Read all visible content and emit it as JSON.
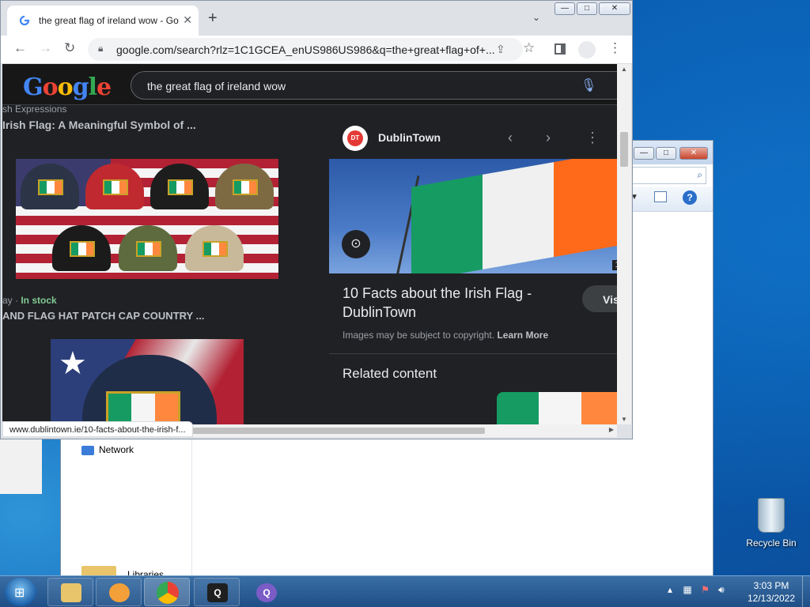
{
  "browser": {
    "tab_title": "the great flag of ireland wow - Go",
    "url": "google.com/search?rlz=1C1GCEA_enUS986US986&q=the+great+flag+of+...",
    "status_url": "www.dublintown.ie/10-facts-about-the-irish-f..."
  },
  "google": {
    "logo": "Google",
    "query": "the great flag of ireland wow"
  },
  "results": {
    "r1_source": "sh Expressions",
    "r1_title": "Irish Flag: A Meaningful Symbol of ...",
    "r2_meta": "ay · ",
    "r2_stock": "In stock",
    "r2_title": "AND FLAG HAT PATCH CAP COUNTRY ..."
  },
  "panel": {
    "source": "DublinTown",
    "logo_text": "DT",
    "badge": "1",
    "title": "10 Facts about the Irish Flag - DublinTown",
    "visit": "Vis",
    "copyright": "Images may be subject to copyright.",
    "learn_more": "Learn More",
    "related": "Related content"
  },
  "explorer": {
    "nav_network": "Network",
    "libraries": "Libraries"
  },
  "desktop": {
    "recycle_bin": "Recycle Bin"
  },
  "taskbar": {
    "time": "3:03 PM",
    "date": "12/13/2022"
  },
  "colors": {
    "irish_green": "#169b62",
    "irish_white": "#f5f5f5",
    "irish_orange": "#ff883e",
    "google_dark": "#202124"
  }
}
